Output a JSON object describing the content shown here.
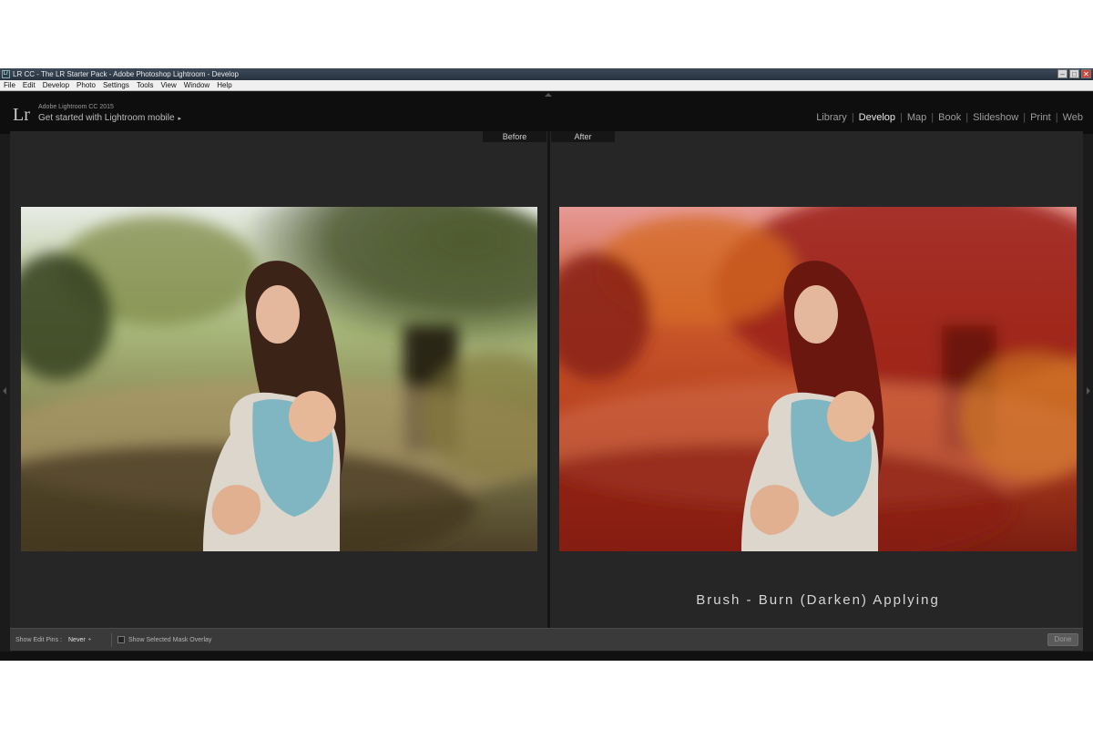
{
  "titlebar": {
    "app_icon": "Lr",
    "title": "LR CC - The LR Starter Pack - Adobe Photoshop Lightroom - Develop",
    "minimize": "–",
    "maximize": "□",
    "close": "✕"
  },
  "menu": [
    "File",
    "Edit",
    "Develop",
    "Photo",
    "Settings",
    "Tools",
    "View",
    "Window",
    "Help"
  ],
  "header": {
    "logo": "Lr",
    "product": "Adobe Lightroom CC 2015",
    "mobile_prompt": "Get started with Lightroom mobile",
    "mobile_arrow": "▸"
  },
  "modules": [
    {
      "label": "Library",
      "active": false
    },
    {
      "label": "Develop",
      "active": true
    },
    {
      "label": "Map",
      "active": false
    },
    {
      "label": "Book",
      "active": false
    },
    {
      "label": "Slideshow",
      "active": false
    },
    {
      "label": "Print",
      "active": false
    },
    {
      "label": "Web",
      "active": false
    }
  ],
  "view": {
    "before_label": "Before",
    "after_label": "After",
    "overlay_text": "Brush - Burn (Darken) Applying"
  },
  "toolbar": {
    "show_edit_pins_label": "Show Edit Pins :",
    "show_edit_pins_value": "Never",
    "show_edit_pins_caret": "÷",
    "mask_overlay_label": "Show Selected Mask Overlay",
    "mask_overlay_checked": false,
    "done_label": "Done"
  },
  "colors": {
    "mask_overlay": "#c8201a",
    "workspace": "#262626",
    "header": "#0e0e0e"
  }
}
